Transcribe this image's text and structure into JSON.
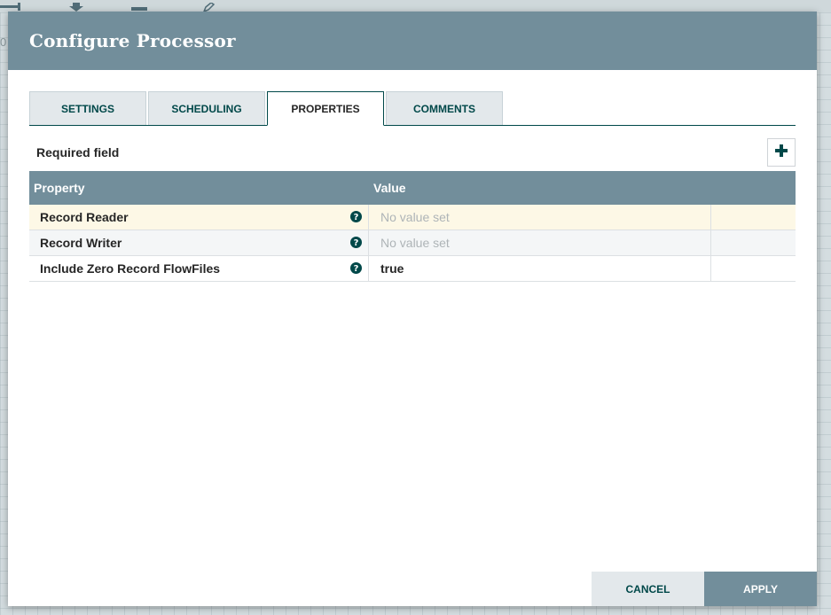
{
  "background": {
    "toolbar_icons": [
      "operations-icon",
      "import-icon",
      "template-icon",
      "pencil-icon"
    ],
    "partial_text": "0"
  },
  "dialog": {
    "title": "Configure Processor"
  },
  "tabs": [
    {
      "label": "SETTINGS",
      "active": false
    },
    {
      "label": "SCHEDULING",
      "active": false
    },
    {
      "label": "PROPERTIES",
      "active": true
    },
    {
      "label": "COMMENTS",
      "active": false
    }
  ],
  "properties_tab": {
    "required_field_label": "Required field",
    "add_property_icon": "plus-icon",
    "columns": {
      "property": "Property",
      "value": "Value"
    },
    "rows": [
      {
        "name": "Record Reader",
        "value": "No value set",
        "value_set": false,
        "selected": true,
        "help_icon": "question-circle-icon"
      },
      {
        "name": "Record Writer",
        "value": "No value set",
        "value_set": false,
        "selected": false,
        "help_icon": "question-circle-icon"
      },
      {
        "name": "Include Zero Record FlowFiles",
        "value": "true",
        "value_set": true,
        "selected": false,
        "help_icon": "question-circle-icon"
      }
    ]
  },
  "footer": {
    "cancel_label": "CANCEL",
    "apply_label": "APPLY"
  },
  "colors": {
    "header": "#728e9b",
    "accent": "#004849",
    "selected_row": "#fdf8e6",
    "unset_value": "#aeb4b7"
  }
}
